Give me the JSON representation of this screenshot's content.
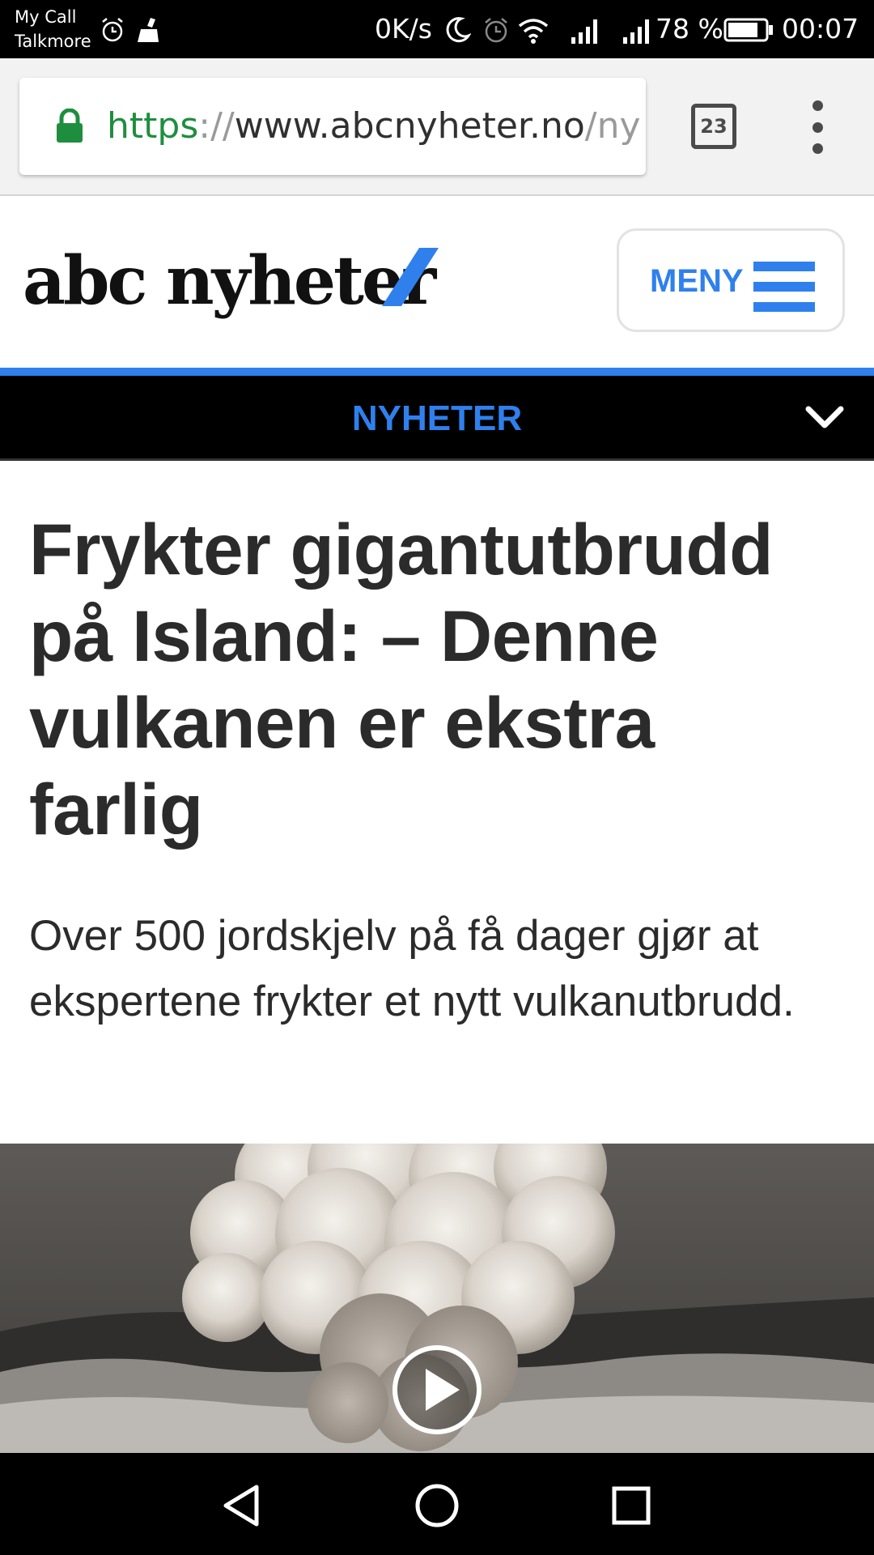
{
  "status_bar": {
    "carrier_line1": "My Call",
    "carrier_line2": "Talkmore",
    "net_speed": "0K/s",
    "battery": "78 %",
    "time": "00:07",
    "icons": [
      "alarm-icon",
      "cleaner-icon",
      "moon-icon",
      "alarm-icon",
      "wifi-icon",
      "signal-icon",
      "signal-icon",
      "battery-icon"
    ]
  },
  "browser": {
    "url_scheme": "https",
    "url_sep": "://",
    "url_host": "www.abcnyheter.no",
    "url_path": "/ny",
    "tab_count": "23"
  },
  "site": {
    "logo_text": "abc nyheter",
    "menu_label": "MENY",
    "section_label": "NYHETER",
    "accent_color": "#2f80ed"
  },
  "article": {
    "headline": "Frykter gigantutbrudd på Island: – Denne vulkanen er ekstra farlig",
    "lead": "Over 500 jordskjelv på få dager gjør at ekspertene frykter et nytt vulkanutbrudd."
  },
  "media": {
    "type": "video",
    "play_icon": "play-icon"
  },
  "nav_bar": {
    "buttons": [
      "back-icon",
      "home-icon",
      "recents-icon"
    ]
  }
}
